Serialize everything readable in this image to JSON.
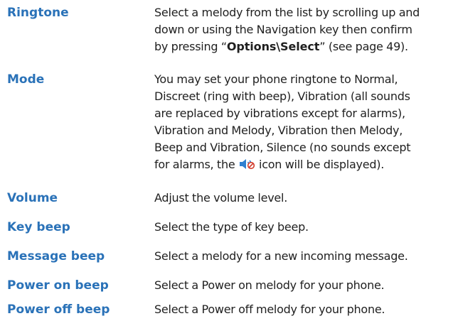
{
  "settings": [
    {
      "term": "Ringtone",
      "lines": [
        "Select a melody from the list by scrolling up and",
        "down or using the Navigation key then confirm",
        "by pressing “"
      ],
      "line3_bold": "Options\\Select",
      "line3_tail": "” (see page 49)."
    },
    {
      "term": "Mode",
      "lines": [
        "You may set your phone ringtone to Normal,",
        "Discreet (ring with beep), Vibration (all sounds",
        "are replaced by vibrations except for alarms),",
        "Vibration and Melody, Vibration then Melody,",
        "Beep and Vibration, Silence (no sounds except",
        "for alarms, the"
      ],
      "line6_tail": "icon will be displayed).",
      "icon": "silent-mode-icon"
    },
    {
      "term": "Volume",
      "lines": [
        "Adjust the volume level."
      ]
    },
    {
      "term": "Key beep",
      "lines": [
        "Select the type of key beep."
      ]
    },
    {
      "term": "Message beep",
      "lines": [
        "Select a melody for a new incoming message."
      ]
    },
    {
      "term": "Power on beep",
      "lines": [
        "Select a Power on melody for your phone."
      ]
    },
    {
      "term": "Power off beep",
      "lines": [
        "Select a Power off melody for your phone."
      ]
    }
  ],
  "colors": {
    "term": "#2a72b8",
    "text": "#1f1f1f",
    "icon_blue": "#2f80d0",
    "icon_slash": "#d23a2a"
  }
}
